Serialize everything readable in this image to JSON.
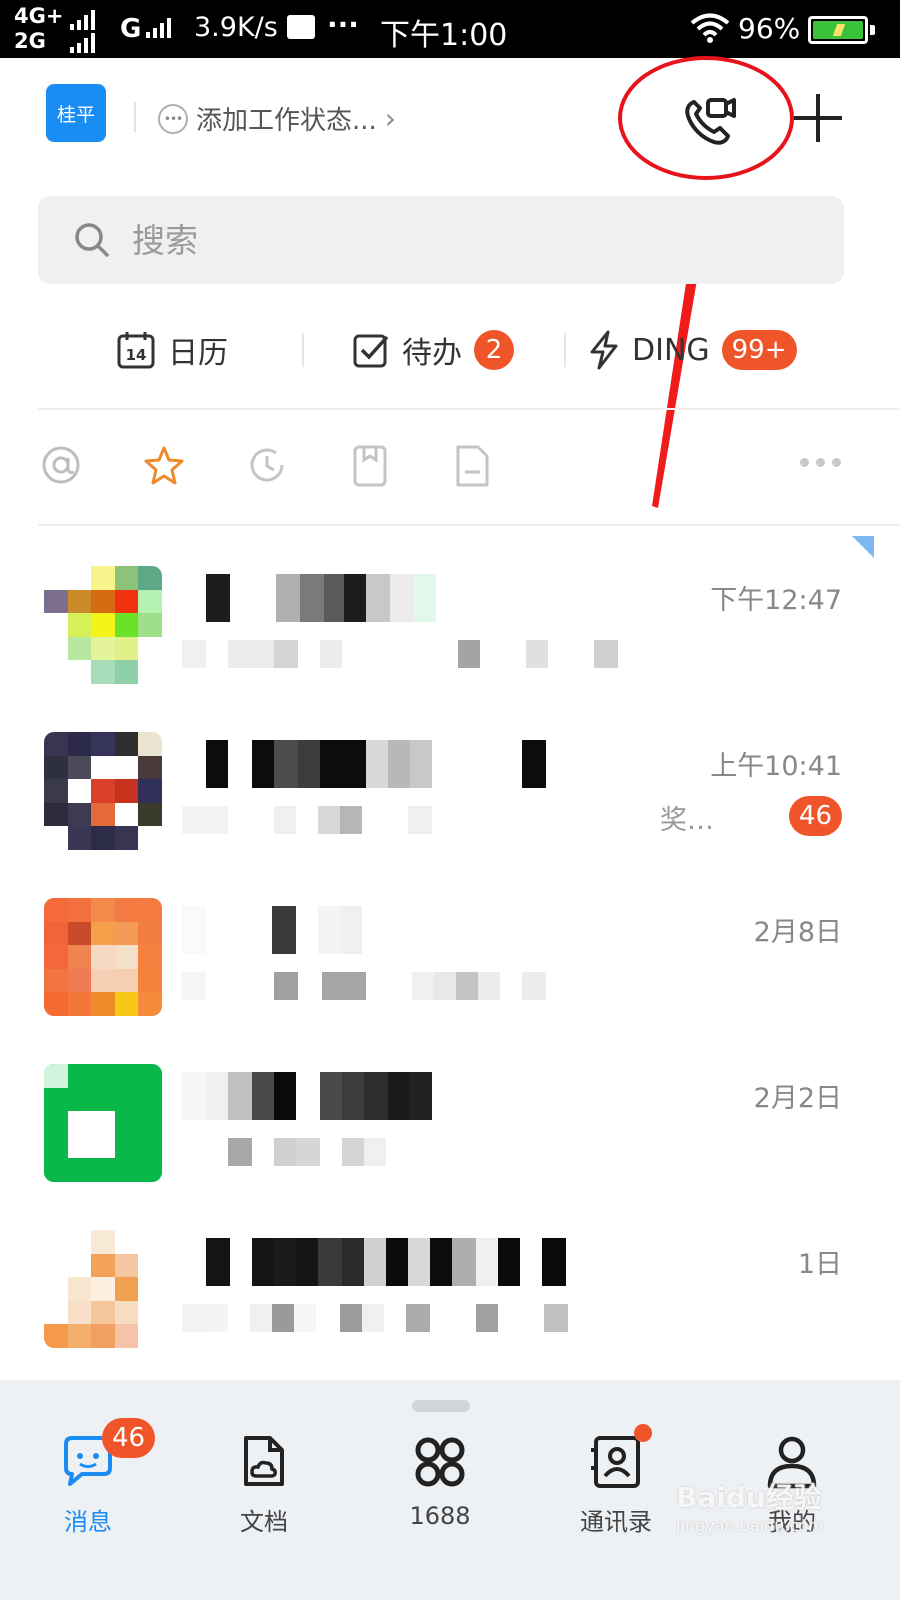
{
  "status_bar": {
    "network_top": "4G+",
    "network_bottom": "2G",
    "carrier2": "G",
    "speed": "3.9K/s",
    "more": "···",
    "time": "下午1:00",
    "battery": "96%"
  },
  "header": {
    "org_chip": "桂平",
    "work_status": "添加工作状态...",
    "work_status_chevron": "›",
    "call_icon": "video-call-icon",
    "add_icon": "plus-icon"
  },
  "search": {
    "placeholder": "搜索"
  },
  "quick_tabs": [
    {
      "label": "日历",
      "icon": "calendar-icon",
      "icon_text": "14"
    },
    {
      "label": "待办",
      "icon": "todo-check-icon",
      "badge": "2"
    },
    {
      "label": "DING",
      "icon": "lightning-icon",
      "badge": "99+"
    }
  ],
  "filters": [
    "at-icon",
    "star-icon",
    "clock-icon",
    "bookmark-icon",
    "document-icon",
    "more-icon"
  ],
  "conversations": [
    {
      "time": "下午12:47",
      "badge": "",
      "extra": ""
    },
    {
      "time": "上午10:41",
      "badge": "46",
      "extra": "奖…"
    },
    {
      "time": "2月8日",
      "badge": "",
      "extra": ""
    },
    {
      "time": "2月2日",
      "badge": "",
      "extra": ""
    },
    {
      "time": "1日",
      "badge": "",
      "extra": ""
    }
  ],
  "bottom_nav": [
    {
      "label": "消息",
      "icon": "message-icon",
      "badge": "46",
      "active": true
    },
    {
      "label": "文档",
      "icon": "document-cloud-icon"
    },
    {
      "label": "1688",
      "icon": "grid-app-icon"
    },
    {
      "label": "通讯录",
      "icon": "contacts-icon",
      "dot": true
    },
    {
      "label": "我的",
      "icon": "profile-icon"
    }
  ],
  "watermark": {
    "main": "Baidu经验",
    "sub": "jingyan.baidu.com"
  },
  "colors": {
    "accent_blue": "#1a8df5",
    "badge_orange": "#f0552a",
    "annotation_red": "#e8121b",
    "search_bg": "#eef0f2",
    "nav_bg": "#eef1f4"
  }
}
